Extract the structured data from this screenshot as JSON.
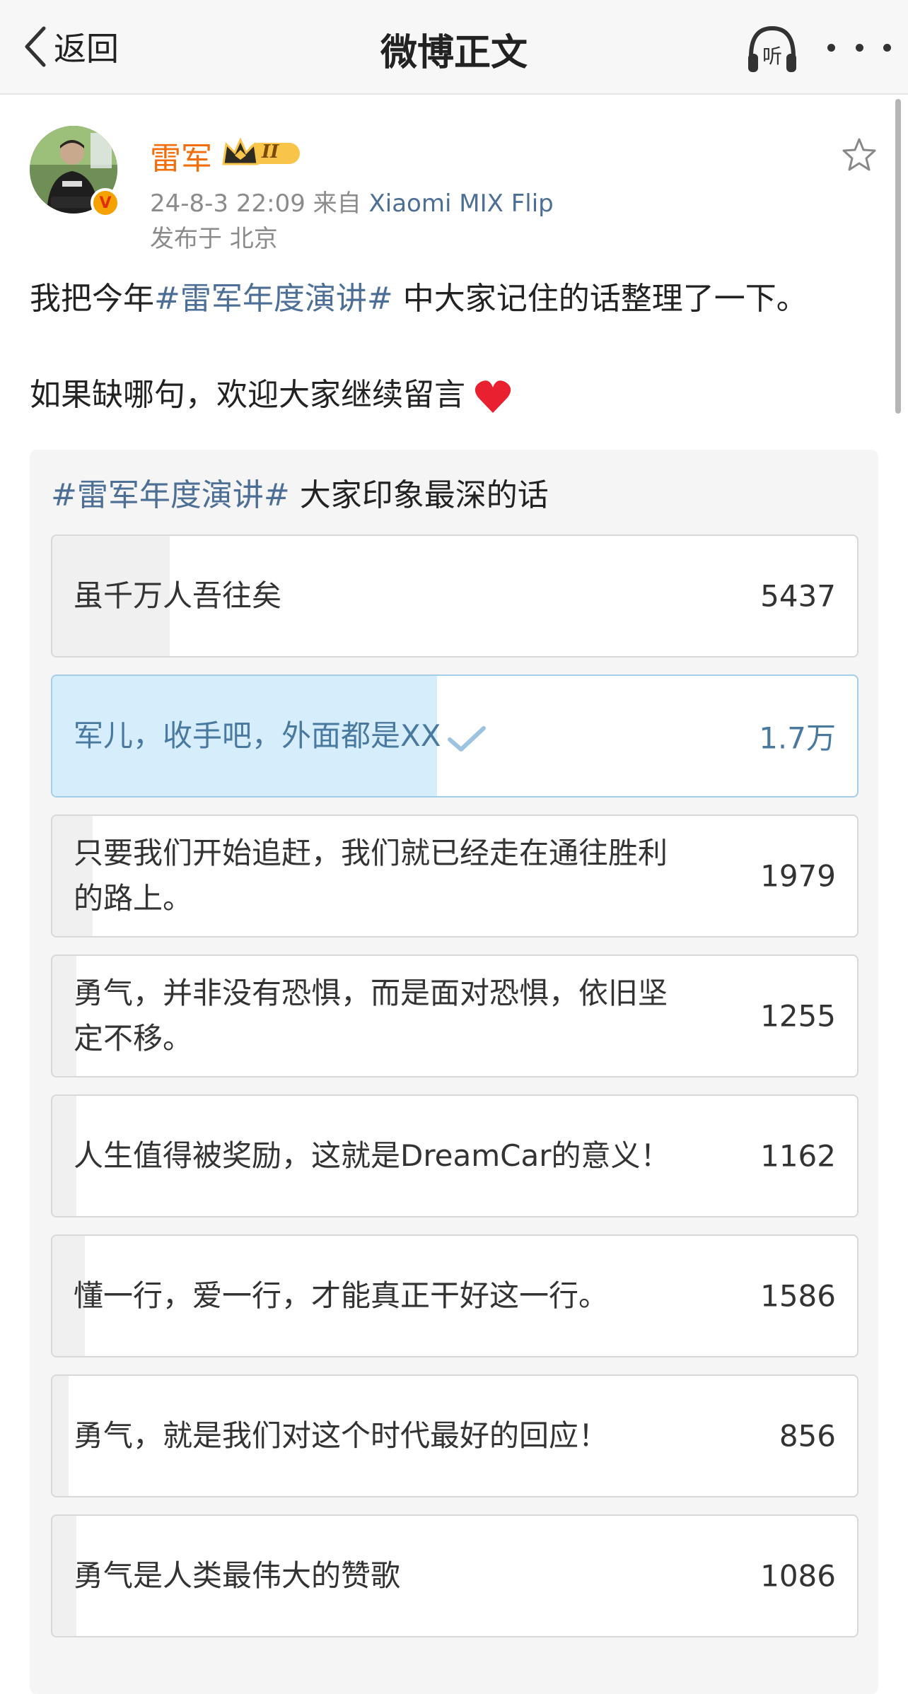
{
  "nav": {
    "back_label": "返回",
    "title": "微博正文",
    "listen_label": "听"
  },
  "author": {
    "name": "雷军",
    "vip_level": "II",
    "post_time": "24-8-3 22:09",
    "source_prefix": "来自",
    "device": "Xiaomi MIX Flip",
    "location": "发布于 北京",
    "verified_mark": "V"
  },
  "post": {
    "line1_before": "我把今年",
    "line1_topic": "#雷军年度演讲#",
    "line1_after": " 中大家记住的话整理了一下。",
    "line2": "如果缺哪句，欢迎大家继续留言"
  },
  "poll": {
    "title_topic": "#雷军年度演讲#",
    "title_rest": " 大家印象最深的话",
    "options": [
      {
        "text": "虽千万人吾往矣",
        "count": "5437",
        "fraction": 0.146
      },
      {
        "text": "军儿，收手吧，外面都是XX",
        "count": "1.7万",
        "fraction": 0.478,
        "selected": true
      },
      {
        "text": "只要我们开始追赶，我们就已经走在通往胜利的路上。",
        "count": "1979",
        "fraction": 0.05
      },
      {
        "text": "勇气，并非没有恐惧，而是面对恐惧，依旧坚定不移。",
        "count": "1255",
        "fraction": 0.03
      },
      {
        "text": "人生值得被奖励，这就是DreamCar的意义！",
        "count": "1162",
        "fraction": 0.03
      },
      {
        "text": "懂一行，爱一行，才能真正干好这一行。",
        "count": "1586",
        "fraction": 0.04
      },
      {
        "text": "勇气，就是我们对这个时代最好的回应！",
        "count": "856",
        "fraction": 0.02
      },
      {
        "text": "勇气是人类最伟大的赞歌",
        "count": "1086",
        "fraction": 0.03
      }
    ]
  }
}
